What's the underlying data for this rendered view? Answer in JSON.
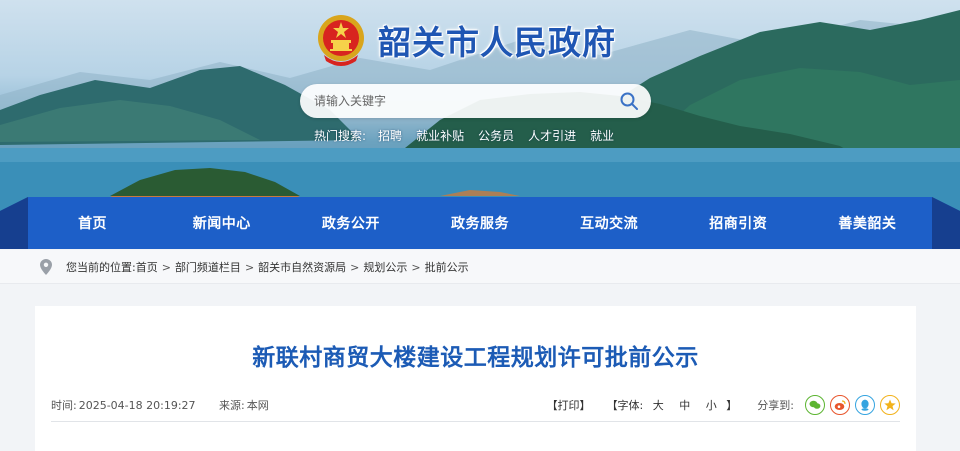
{
  "site": {
    "title": "韶关市人民政府"
  },
  "search": {
    "placeholder": "请输入关键字"
  },
  "hot_search": {
    "label": "热门搜索:",
    "items": [
      "招聘",
      "就业补贴",
      "公务员",
      "人才引进",
      "就业"
    ]
  },
  "nav": {
    "items": [
      "首页",
      "新闻中心",
      "政务公开",
      "政务服务",
      "互动交流",
      "招商引资",
      "善美韶关"
    ]
  },
  "breadcrumb": {
    "prefix": "您当前的位置:",
    "items": [
      "首页",
      "部门频道栏目",
      "韶关市自然资源局",
      "规划公示",
      "批前公示"
    ],
    "separator": ">"
  },
  "article": {
    "title": "新联村商贸大楼建设工程规划许可批前公示",
    "time_label": "时间:",
    "time": "2025-04-18 20:19:27",
    "source_label": "来源:",
    "source": "本网",
    "print_label": "【打印】",
    "font_label": "【字体:",
    "font_sizes": [
      "大",
      "中",
      "小"
    ],
    "font_close": "】",
    "share_label": "分享到:",
    "share_icons": [
      "wechat-icon",
      "weibo-icon",
      "qq-icon",
      "qzone-icon"
    ]
  },
  "colors": {
    "nav_blue": "#1d5fc8",
    "title_blue": "#1c5bb5",
    "wechat": "#5cb531",
    "weibo": "#e8562c",
    "qq": "#35a4e0",
    "qzone": "#f2b21c"
  }
}
